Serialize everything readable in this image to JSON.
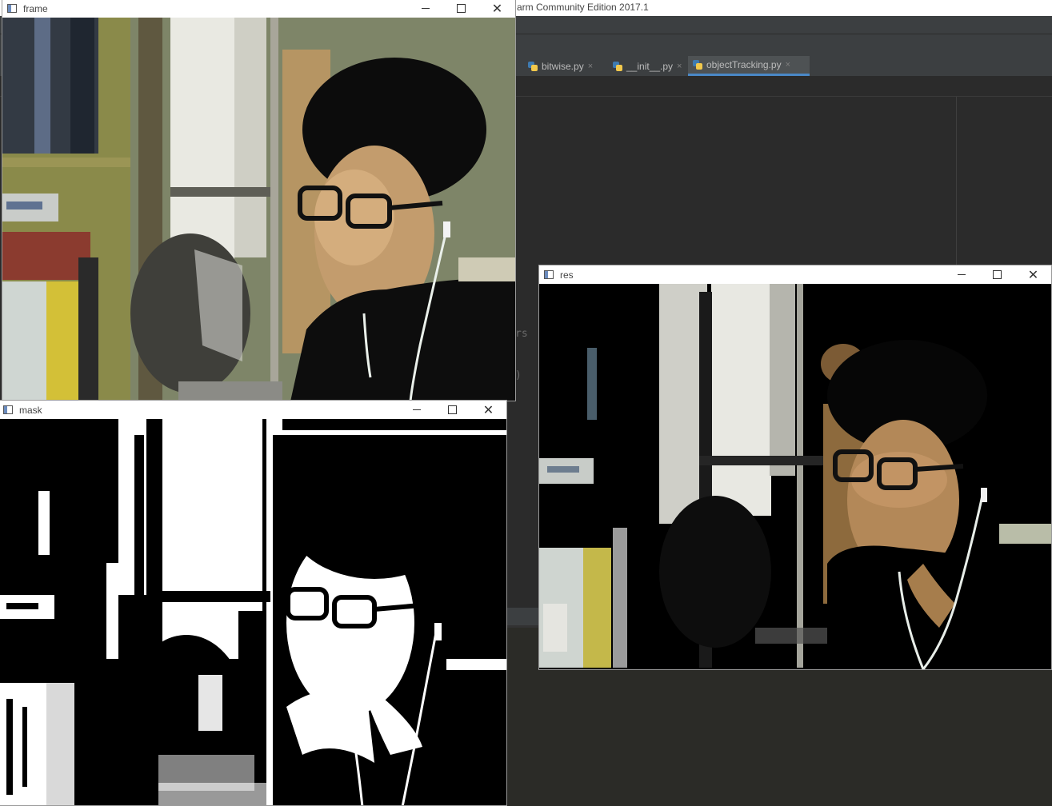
{
  "ide": {
    "title": "arm Community Edition 2017.1",
    "tabs": [
      {
        "label": "bitwise.py",
        "close": "×"
      },
      {
        "label": "__init__.py",
        "close": "×"
      },
      {
        "label": "objectTracking.py",
        "close": "×"
      }
    ],
    "fragments": {
      "text1": "rs",
      "text2": ")"
    }
  },
  "windows": {
    "frame": {
      "title": "frame"
    },
    "mask": {
      "title": "mask"
    },
    "res": {
      "title": "res"
    }
  },
  "controls": {
    "minimize": "minimize-icon",
    "maximize": "maximize-icon",
    "close": "close-icon",
    "close_glyph": "✕"
  },
  "colors": {
    "ide_bg": "#2b2b2b",
    "tab_accent": "#4a88c7",
    "titlebar": "#ffffff"
  }
}
